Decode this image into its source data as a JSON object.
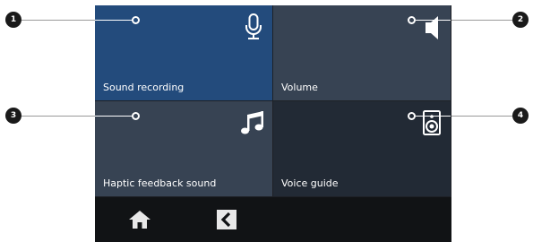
{
  "tiles": [
    {
      "label": "Sound recording",
      "icon": "microphone-icon"
    },
    {
      "label": "Volume",
      "icon": "speaker-volume-icon"
    },
    {
      "label": "Haptic feedback sound",
      "icon": "music-note-icon"
    },
    {
      "label": "Voice guide",
      "icon": "loudspeaker-icon"
    }
  ],
  "callouts": [
    "1",
    "2",
    "3",
    "4"
  ],
  "navbar": {
    "home_icon": "home-icon",
    "back_icon": "back-icon"
  },
  "colors": {
    "tile_selected": "#234b7c",
    "tile_default": "#374353",
    "tile_dark": "#222a35",
    "navbar_bg": "#111315",
    "badge_bg": "#1a1a1a"
  }
}
